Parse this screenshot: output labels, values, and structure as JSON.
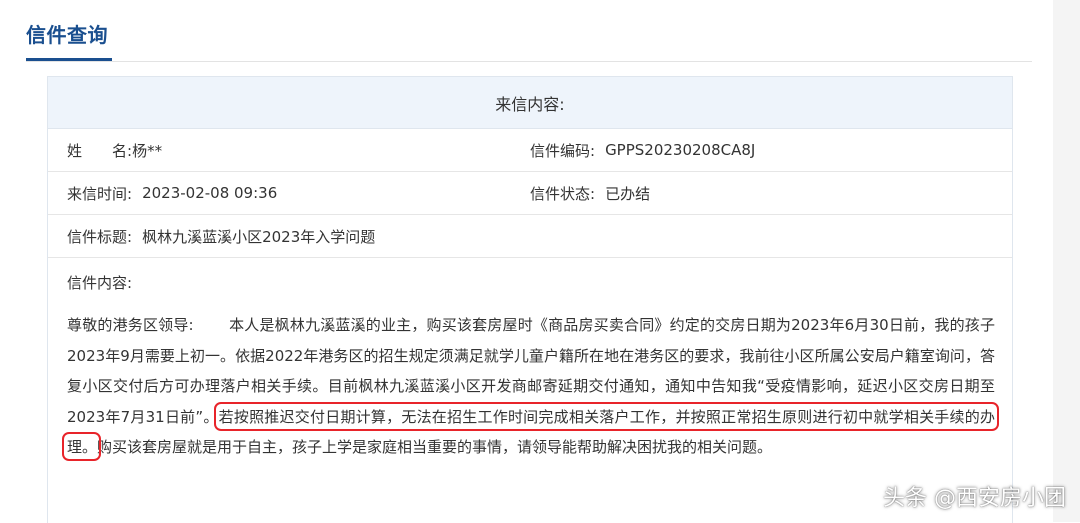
{
  "page_title": "信件查询",
  "card_header": "来信内容:",
  "fields": {
    "name_label": "姓　　名:",
    "name_value": "杨**",
    "code_label": "信件编码:",
    "code_value": "GPPS20230208CA8J",
    "time_label": "来信时间:",
    "time_value": "2023-02-08 09:36",
    "status_label": "信件状态:",
    "status_value": "已办结",
    "subject_label": "信件标题:",
    "subject_value": "枫林九溪蓝溪小区2023年入学问题"
  },
  "content": {
    "label": "信件内容:",
    "part1": "尊敬的港务区领导:　　 本人是枫林九溪蓝溪的业主，购买该套房屋时《商品房买卖合同》约定的交房日期为2023年6月30日前，我的孩子2023年9月需要上初一。依据2022年港务区的招生规定须满足就学儿童户籍所在地在港务区的要求，我前往小区所属公安局户籍室询问，答复小区交付后方可办理落户相关手续。目前枫林九溪蓝溪小区开发商邮寄延期交付通知，通知中告知我“受疫情影响，延迟小区交房日期至2023年7月31日前”。",
    "highlight": "若按照推迟交付日期计算，无法在招生工作时间完成相关落户工作，并按照正常招生原则进行初中就学相关手续的办理。",
    "part2": "购买该套房屋就是用于自主，孩子上学是家庭相当重要的事情，请领导能帮助解决困扰我的相关问题。"
  },
  "watermark": "头条 @西安房小团",
  "colors": {
    "accent": "#1a4f8f",
    "header_bg": "#eef4fb",
    "highlight_border": "#e8242a"
  }
}
